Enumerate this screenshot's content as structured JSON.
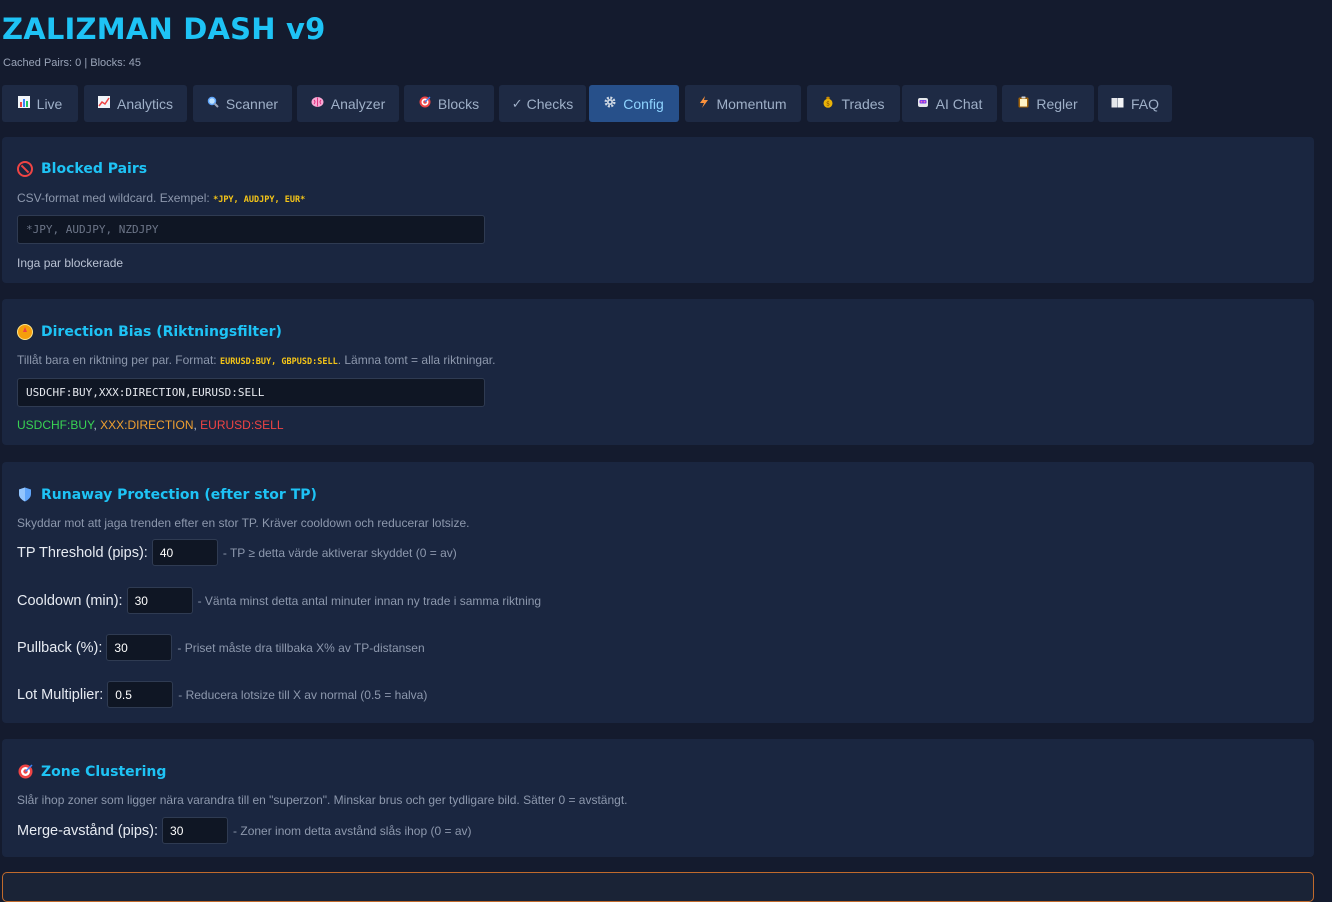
{
  "header": {
    "title": "ZALIZMAN DASH v9",
    "subtitle": "Cached Pairs: 0 | Blocks: 45"
  },
  "tabs": [
    {
      "label": "Live",
      "icon": "bar-chart-icon"
    },
    {
      "label": "Analytics",
      "icon": "trend-chart-icon"
    },
    {
      "label": "Scanner",
      "icon": "magnifier-icon"
    },
    {
      "label": "Analyzer",
      "icon": "brain-icon"
    },
    {
      "label": "Blocks",
      "icon": "target-icon"
    },
    {
      "label": "Checks",
      "icon": "check-icon",
      "glyph": "✓"
    },
    {
      "label": "Config",
      "icon": "gear-icon",
      "active": true
    },
    {
      "label": "Momentum",
      "icon": "lightning-icon"
    },
    {
      "label": "Trades",
      "icon": "money-bag-icon"
    },
    {
      "label": "AI Chat",
      "icon": "robot-icon"
    },
    {
      "label": "Regler",
      "icon": "clipboard-icon"
    },
    {
      "label": "FAQ",
      "icon": "book-icon"
    }
  ],
  "blocked_pairs": {
    "title": "Blocked Pairs",
    "icon": "prohibited-icon",
    "desc": "CSV-format med wildcard. Exempel:",
    "example": "*JPY, AUDJPY, EUR*",
    "input_value": "",
    "placeholder": "*JPY, AUDJPY, NZDJPY",
    "status": "Inga par blockerade"
  },
  "direction_bias": {
    "title": "Direction Bias (Riktningsfilter)",
    "icon": "compass-icon",
    "desc_before": "Tillåt bara en riktning per par. Format:",
    "example": "EURUSD:BUY, GBPUSD:SELL",
    "desc_after": ". Lämna tomt = alla riktningar.",
    "input_value": "USDCHF:BUY,XXX:DIRECTION,EURUSD:SELL",
    "tokens": [
      {
        "text": "USDCHF:BUY",
        "color": "#39d353"
      },
      {
        "text": "XXX:DIRECTION",
        "color": "#f0a030"
      },
      {
        "text": "EURUSD:SELL",
        "color": "#ef4444"
      }
    ],
    "separator": ", "
  },
  "runaway": {
    "title": "Runaway Protection (efter stor TP)",
    "icon": "shield-icon",
    "desc": "Skyddar mot att jaga trenden efter en stor TP. Kräver cooldown och reducerar lotsize.",
    "fields": [
      {
        "label": "TP Threshold (pips):",
        "value": "40",
        "hint": "- TP ≥ detta värde aktiverar skyddet (0 = av)"
      },
      {
        "label": "Cooldown (min):",
        "value": "30",
        "hint": "- Vänta minst detta antal minuter innan ny trade i samma riktning"
      },
      {
        "label": "Pullback (%):",
        "value": "30",
        "hint": "- Priset måste dra tillbaka X% av TP-distansen"
      },
      {
        "label": "Lot Multiplier:",
        "value": "0.5",
        "hint": "- Reducera lotsize till X av normal (0.5 = halva)"
      }
    ]
  },
  "zone_clustering": {
    "title": "Zone Clustering",
    "icon": "target-icon",
    "desc": "Slår ihop zoner som ligger nära varandra till en \"superzon\". Minskar brus och ger tydligare bild. Sätter 0 = avstängt.",
    "field": {
      "label": "Merge-avstånd (pips):",
      "value": "30",
      "hint": "- Zoner inom detta avstånd slås ihop (0 = av)"
    }
  },
  "colors": {
    "accent": "#1ec3f5",
    "background": "#141b2e",
    "panel": "#1a2640",
    "tab": "#1e2a44",
    "tab_active": "#27508a",
    "code": "#f5c518"
  }
}
